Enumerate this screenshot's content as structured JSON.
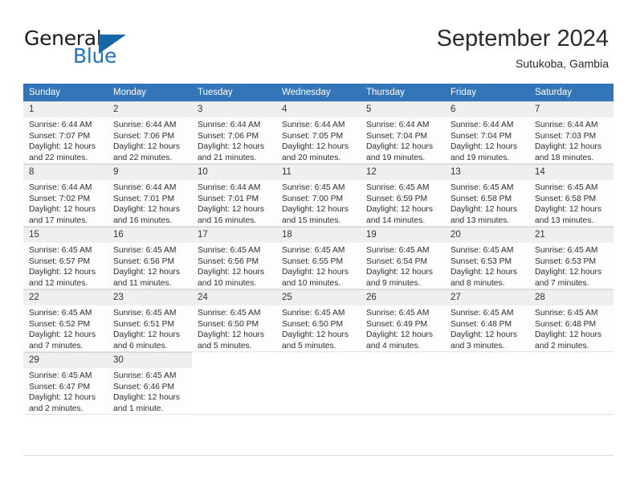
{
  "brand": {
    "name_part1": "General",
    "name_part2": "Blue",
    "flag_icon": "triangle-flag-icon",
    "accent_color": "#2272b8"
  },
  "header": {
    "month_title": "September 2024",
    "location": "Sutukoba, Gambia"
  },
  "calendar": {
    "header_bg": "#3275b8",
    "daynum_bg": "#efefef",
    "weekday_headers": [
      "Sunday",
      "Monday",
      "Tuesday",
      "Wednesday",
      "Thursday",
      "Friday",
      "Saturday"
    ],
    "weeks": [
      [
        {
          "day": "1",
          "sunrise": "Sunrise: 6:44 AM",
          "sunset": "Sunset: 7:07 PM",
          "daylight_line1": "Daylight: 12 hours",
          "daylight_line2": "and 22 minutes."
        },
        {
          "day": "2",
          "sunrise": "Sunrise: 6:44 AM",
          "sunset": "Sunset: 7:06 PM",
          "daylight_line1": "Daylight: 12 hours",
          "daylight_line2": "and 22 minutes."
        },
        {
          "day": "3",
          "sunrise": "Sunrise: 6:44 AM",
          "sunset": "Sunset: 7:06 PM",
          "daylight_line1": "Daylight: 12 hours",
          "daylight_line2": "and 21 minutes."
        },
        {
          "day": "4",
          "sunrise": "Sunrise: 6:44 AM",
          "sunset": "Sunset: 7:05 PM",
          "daylight_line1": "Daylight: 12 hours",
          "daylight_line2": "and 20 minutes."
        },
        {
          "day": "5",
          "sunrise": "Sunrise: 6:44 AM",
          "sunset": "Sunset: 7:04 PM",
          "daylight_line1": "Daylight: 12 hours",
          "daylight_line2": "and 19 minutes."
        },
        {
          "day": "6",
          "sunrise": "Sunrise: 6:44 AM",
          "sunset": "Sunset: 7:04 PM",
          "daylight_line1": "Daylight: 12 hours",
          "daylight_line2": "and 19 minutes."
        },
        {
          "day": "7",
          "sunrise": "Sunrise: 6:44 AM",
          "sunset": "Sunset: 7:03 PM",
          "daylight_line1": "Daylight: 12 hours",
          "daylight_line2": "and 18 minutes."
        }
      ],
      [
        {
          "day": "8",
          "sunrise": "Sunrise: 6:44 AM",
          "sunset": "Sunset: 7:02 PM",
          "daylight_line1": "Daylight: 12 hours",
          "daylight_line2": "and 17 minutes."
        },
        {
          "day": "9",
          "sunrise": "Sunrise: 6:44 AM",
          "sunset": "Sunset: 7:01 PM",
          "daylight_line1": "Daylight: 12 hours",
          "daylight_line2": "and 16 minutes."
        },
        {
          "day": "10",
          "sunrise": "Sunrise: 6:44 AM",
          "sunset": "Sunset: 7:01 PM",
          "daylight_line1": "Daylight: 12 hours",
          "daylight_line2": "and 16 minutes."
        },
        {
          "day": "11",
          "sunrise": "Sunrise: 6:45 AM",
          "sunset": "Sunset: 7:00 PM",
          "daylight_line1": "Daylight: 12 hours",
          "daylight_line2": "and 15 minutes."
        },
        {
          "day": "12",
          "sunrise": "Sunrise: 6:45 AM",
          "sunset": "Sunset: 6:59 PM",
          "daylight_line1": "Daylight: 12 hours",
          "daylight_line2": "and 14 minutes."
        },
        {
          "day": "13",
          "sunrise": "Sunrise: 6:45 AM",
          "sunset": "Sunset: 6:58 PM",
          "daylight_line1": "Daylight: 12 hours",
          "daylight_line2": "and 13 minutes."
        },
        {
          "day": "14",
          "sunrise": "Sunrise: 6:45 AM",
          "sunset": "Sunset: 6:58 PM",
          "daylight_line1": "Daylight: 12 hours",
          "daylight_line2": "and 13 minutes."
        }
      ],
      [
        {
          "day": "15",
          "sunrise": "Sunrise: 6:45 AM",
          "sunset": "Sunset: 6:57 PM",
          "daylight_line1": "Daylight: 12 hours",
          "daylight_line2": "and 12 minutes."
        },
        {
          "day": "16",
          "sunrise": "Sunrise: 6:45 AM",
          "sunset": "Sunset: 6:56 PM",
          "daylight_line1": "Daylight: 12 hours",
          "daylight_line2": "and 11 minutes."
        },
        {
          "day": "17",
          "sunrise": "Sunrise: 6:45 AM",
          "sunset": "Sunset: 6:56 PM",
          "daylight_line1": "Daylight: 12 hours",
          "daylight_line2": "and 10 minutes."
        },
        {
          "day": "18",
          "sunrise": "Sunrise: 6:45 AM",
          "sunset": "Sunset: 6:55 PM",
          "daylight_line1": "Daylight: 12 hours",
          "daylight_line2": "and 10 minutes."
        },
        {
          "day": "19",
          "sunrise": "Sunrise: 6:45 AM",
          "sunset": "Sunset: 6:54 PM",
          "daylight_line1": "Daylight: 12 hours",
          "daylight_line2": "and 9 minutes."
        },
        {
          "day": "20",
          "sunrise": "Sunrise: 6:45 AM",
          "sunset": "Sunset: 6:53 PM",
          "daylight_line1": "Daylight: 12 hours",
          "daylight_line2": "and 8 minutes."
        },
        {
          "day": "21",
          "sunrise": "Sunrise: 6:45 AM",
          "sunset": "Sunset: 6:53 PM",
          "daylight_line1": "Daylight: 12 hours",
          "daylight_line2": "and 7 minutes."
        }
      ],
      [
        {
          "day": "22",
          "sunrise": "Sunrise: 6:45 AM",
          "sunset": "Sunset: 6:52 PM",
          "daylight_line1": "Daylight: 12 hours",
          "daylight_line2": "and 7 minutes."
        },
        {
          "day": "23",
          "sunrise": "Sunrise: 6:45 AM",
          "sunset": "Sunset: 6:51 PM",
          "daylight_line1": "Daylight: 12 hours",
          "daylight_line2": "and 6 minutes."
        },
        {
          "day": "24",
          "sunrise": "Sunrise: 6:45 AM",
          "sunset": "Sunset: 6:50 PM",
          "daylight_line1": "Daylight: 12 hours",
          "daylight_line2": "and 5 minutes."
        },
        {
          "day": "25",
          "sunrise": "Sunrise: 6:45 AM",
          "sunset": "Sunset: 6:50 PM",
          "daylight_line1": "Daylight: 12 hours",
          "daylight_line2": "and 5 minutes."
        },
        {
          "day": "26",
          "sunrise": "Sunrise: 6:45 AM",
          "sunset": "Sunset: 6:49 PM",
          "daylight_line1": "Daylight: 12 hours",
          "daylight_line2": "and 4 minutes."
        },
        {
          "day": "27",
          "sunrise": "Sunrise: 6:45 AM",
          "sunset": "Sunset: 6:48 PM",
          "daylight_line1": "Daylight: 12 hours",
          "daylight_line2": "and 3 minutes."
        },
        {
          "day": "28",
          "sunrise": "Sunrise: 6:45 AM",
          "sunset": "Sunset: 6:48 PM",
          "daylight_line1": "Daylight: 12 hours",
          "daylight_line2": "and 2 minutes."
        }
      ],
      [
        {
          "day": "29",
          "sunrise": "Sunrise: 6:45 AM",
          "sunset": "Sunset: 6:47 PM",
          "daylight_line1": "Daylight: 12 hours",
          "daylight_line2": "and 2 minutes."
        },
        {
          "day": "30",
          "sunrise": "Sunrise: 6:45 AM",
          "sunset": "Sunset: 6:46 PM",
          "daylight_line1": "Daylight: 12 hours",
          "daylight_line2": "and 1 minute."
        },
        {
          "day": "",
          "sunrise": "",
          "sunset": "",
          "daylight_line1": "",
          "daylight_line2": ""
        },
        {
          "day": "",
          "sunrise": "",
          "sunset": "",
          "daylight_line1": "",
          "daylight_line2": ""
        },
        {
          "day": "",
          "sunrise": "",
          "sunset": "",
          "daylight_line1": "",
          "daylight_line2": ""
        },
        {
          "day": "",
          "sunrise": "",
          "sunset": "",
          "daylight_line1": "",
          "daylight_line2": ""
        },
        {
          "day": "",
          "sunrise": "",
          "sunset": "",
          "daylight_line1": "",
          "daylight_line2": ""
        }
      ]
    ]
  }
}
